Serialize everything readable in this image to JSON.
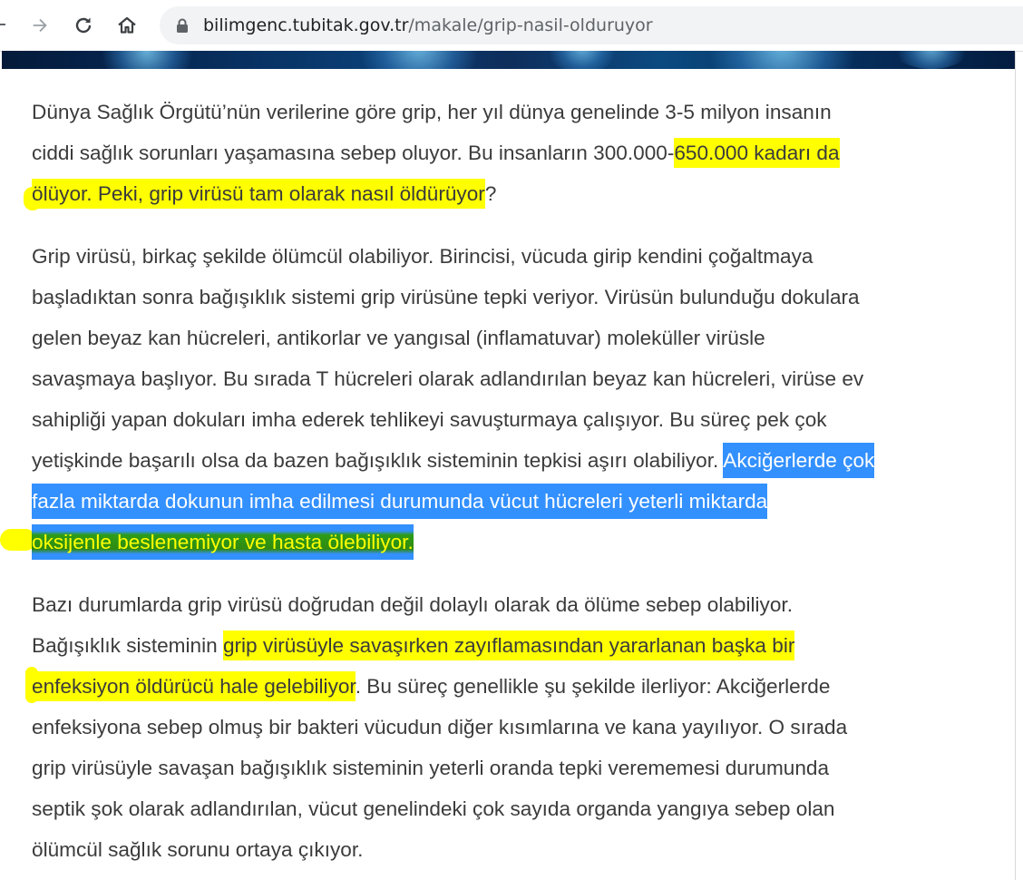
{
  "browser": {
    "url_host": "bilimgenc.tubitak.gov.tr",
    "url_path": "/makale/grip-nasil-olduruyor"
  },
  "article": {
    "p1": {
      "l1": "Dünya Sağlık Örgütü’nün verilerine göre grip, her yıl dünya genelinde 3-5 milyon insanın",
      "l2_a": "ciddi sağlık sorunları yaşamasına sebep oluyor. Bu insanların 300.000-",
      "l2_b": "650.000 kadarı da",
      "l3_a": "ölüyor. Peki, grip virüsü tam olarak nasıl öldürüyor",
      "l3_b": "?"
    },
    "p2": {
      "l1": "Grip virüsü, birkaç şekilde ölümcül olabiliyor. Birincisi, vücuda girip kendini çoğaltmaya",
      "l2": "başladıktan sonra bağışıklık sistemi grip virüsüne tepki veriyor. Virüsün bulunduğu dokulara",
      "l3": "gelen beyaz kan hücreleri, antikorlar ve yangısal (inflamatuvar) moleküller virüsle",
      "l4": "savaşmaya başlıyor. Bu sırada T hücreleri olarak adlandırılan beyaz kan hücreleri, virüse ev",
      "l5": "sahipliği yapan dokuları imha ederek tehlikeyi savuşturmaya çalışıyor. Bu süreç pek çok",
      "l6_a": "yetişkinde başarılı olsa da bazen bağışıklık sisteminin tepkisi aşırı olabiliyor. ",
      "l6_b": "Akciğerlerde çok",
      "l7": "fazla miktarda dokunun imha edilmesi durumunda vücut hücreleri yeterli miktarda",
      "l8": "oksijenle beslenemiyor ve hasta ölebiliyor."
    },
    "p3": {
      "l1": "Bazı durumlarda grip virüsü doğrudan değil dolaylı olarak da ölüme sebep olabiliyor.",
      "l2_a": "Bağışıklık sisteminin ",
      "l2_b": "grip virüsüyle savaşırken zayıflamasından yararlanan başka bir",
      "l3_a": "enfeksiyon öldürücü hale gelebiliyor",
      "l3_b": ". Bu süreç genellikle şu şekilde ilerliyor: Akciğerlerde",
      "l4": "enfeksiyona sebep olmuş bir bakteri vücudun diğer kısımlarına ve kana yayılıyor. O sırada",
      "l5": "grip virüsüyle savaşan bağışıklık sisteminin yeterli oranda tepki verememesi durumunda",
      "l6": "septik şok olarak adlandırılan, vücut genelindeki çok sayıda organda yangıya sebep olan",
      "l7": "ölümcül sağlık sorunu ortaya çıkıyor."
    }
  },
  "colors": {
    "highlight": "#ffff00",
    "selection": "#3390ff",
    "text": "#3b3b3b"
  },
  "icons": [
    "forward-arrow-icon",
    "reload-icon",
    "home-icon",
    "lock-icon"
  ]
}
